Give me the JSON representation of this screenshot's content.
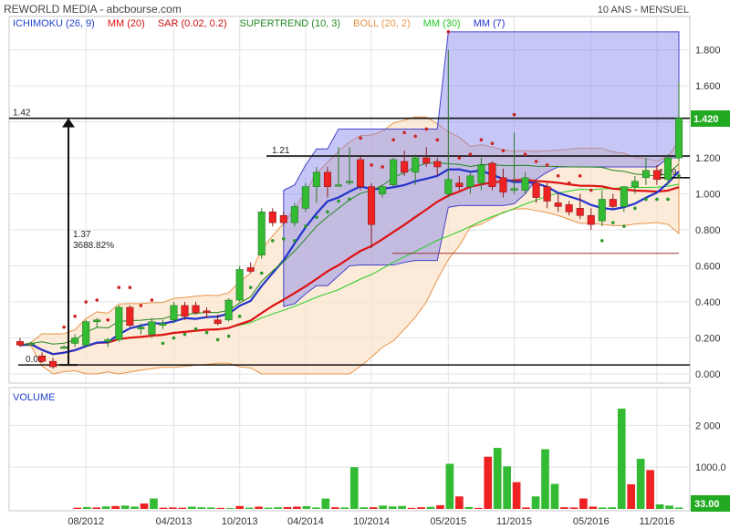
{
  "header": {
    "title": "REWORLD MEDIA - abcbourse.com",
    "period": "10 ANS - MENSUEL"
  },
  "legend": [
    {
      "label": "ICHIMOKU (26, 9)",
      "color": "#2244cc"
    },
    {
      "label": "MM (20)",
      "color": "#dd1111"
    },
    {
      "label": "SAR (0.02, 0.2)",
      "color": "#cc1111"
    },
    {
      "label": "SUPERTREND (10, 3)",
      "color": "#228822"
    },
    {
      "label": "BOLL (20, 2)",
      "color": "#e8944a"
    },
    {
      "label": "MM (30)",
      "color": "#22cc22"
    },
    {
      "label": "MM (7)",
      "color": "#2233cc"
    }
  ],
  "annotations": {
    "high_level": "1.42",
    "resistance": "1.21",
    "support": "1.09",
    "low_level": "0.05",
    "move_abs": "1.37",
    "move_pct": "3688.82%",
    "last_price": "1.420",
    "last_volume": "33.00"
  },
  "volume_panel": {
    "title": "VOLUME"
  },
  "colors": {
    "up": "#33bb33",
    "down": "#ee2222",
    "price_tag": "#22aa22",
    "cloud": "#8080ee"
  },
  "chart_data": [
    {
      "type": "candlestick",
      "title": "REWORLD MEDIA",
      "y_ticks": [
        "0.000",
        "0.200",
        "0.400",
        "0.600",
        "0.800",
        "1.000",
        "1.200",
        "1.400",
        "1.600",
        "1.800"
      ],
      "ylim": [
        0,
        1.95
      ],
      "x_ticks": [
        "08/2012",
        "04/2013",
        "10/2013",
        "04/2014",
        "10/2014",
        "05/2015",
        "11/2015",
        "05/2016",
        "11/2016"
      ],
      "ohlc": [
        [
          0.18,
          0.2,
          0.15,
          0.16
        ],
        [
          0.17,
          0.18,
          0.16,
          0.17
        ],
        [
          0.1,
          0.12,
          0.06,
          0.07
        ],
        [
          0.07,
          0.09,
          0.03,
          0.04
        ],
        [
          0.15,
          0.16,
          0.14,
          0.15
        ],
        [
          0.17,
          0.22,
          0.15,
          0.2
        ],
        [
          0.16,
          0.3,
          0.15,
          0.29
        ],
        [
          0.29,
          0.31,
          0.26,
          0.3
        ],
        [
          0.18,
          0.2,
          0.15,
          0.19
        ],
        [
          0.19,
          0.38,
          0.18,
          0.37
        ],
        [
          0.37,
          0.38,
          0.26,
          0.27
        ],
        [
          0.25,
          0.28,
          0.22,
          0.26
        ],
        [
          0.22,
          0.31,
          0.2,
          0.29
        ],
        [
          0.27,
          0.3,
          0.25,
          0.28
        ],
        [
          0.3,
          0.4,
          0.28,
          0.38
        ],
        [
          0.38,
          0.4,
          0.3,
          0.32
        ],
        [
          0.38,
          0.4,
          0.33,
          0.34
        ],
        [
          0.35,
          0.37,
          0.31,
          0.34
        ],
        [
          0.3,
          0.33,
          0.27,
          0.28
        ],
        [
          0.3,
          0.42,
          0.29,
          0.41
        ],
        [
          0.41,
          0.6,
          0.4,
          0.58
        ],
        [
          0.59,
          0.62,
          0.56,
          0.57
        ],
        [
          0.66,
          0.92,
          0.64,
          0.9
        ],
        [
          0.9,
          0.92,
          0.82,
          0.84
        ],
        [
          0.88,
          0.9,
          0.83,
          0.84
        ],
        [
          0.84,
          0.95,
          0.82,
          0.93
        ],
        [
          0.92,
          1.06,
          0.9,
          1.04
        ],
        [
          1.04,
          1.15,
          0.95,
          1.12
        ],
        [
          1.12,
          1.15,
          0.98,
          1.04
        ],
        [
          1.05,
          1.26,
          1.04,
          1.05
        ],
        [
          1.07,
          1.26,
          1.05,
          1.07
        ],
        [
          1.19,
          1.21,
          1.02,
          1.04
        ],
        [
          1.04,
          1.06,
          0.7,
          0.83
        ],
        [
          1.0,
          1.05,
          0.98,
          1.04
        ],
        [
          1.05,
          1.2,
          1.04,
          1.19
        ],
        [
          1.18,
          1.24,
          1.1,
          1.12
        ],
        [
          1.12,
          1.22,
          1.05,
          1.2
        ],
        [
          1.2,
          1.26,
          1.15,
          1.17
        ],
        [
          1.18,
          1.2,
          1.1,
          1.15
        ],
        [
          1.0,
          1.8,
          0.98,
          1.08
        ],
        [
          1.06,
          1.1,
          1.02,
          1.04
        ],
        [
          1.04,
          1.12,
          1.0,
          1.1
        ],
        [
          1.06,
          1.2,
          1.02,
          1.16
        ],
        [
          1.17,
          1.18,
          1.02,
          1.04
        ],
        [
          1.09,
          1.14,
          0.98,
          1.01
        ],
        [
          1.02,
          1.34,
          1.0,
          1.03
        ],
        [
          1.02,
          1.12,
          1.0,
          1.09
        ],
        [
          1.06,
          1.08,
          0.95,
          0.98
        ],
        [
          1.04,
          1.06,
          0.92,
          0.96
        ],
        [
          0.95,
          1.0,
          0.9,
          0.93
        ],
        [
          0.94,
          0.96,
          0.88,
          0.9
        ],
        [
          0.92,
          1.0,
          0.86,
          0.88
        ],
        [
          0.88,
          0.92,
          0.8,
          0.83
        ],
        [
          0.85,
          1.02,
          0.82,
          0.97
        ],
        [
          0.97,
          1.0,
          0.92,
          0.93
        ],
        [
          0.93,
          1.0,
          0.9,
          1.04
        ],
        [
          1.04,
          1.1,
          1.0,
          1.07
        ],
        [
          1.09,
          1.2,
          1.05,
          1.13
        ],
        [
          1.13,
          1.16,
          1.05,
          1.08
        ],
        [
          1.08,
          1.22,
          1.05,
          1.2
        ],
        [
          1.2,
          1.62,
          1.18,
          1.42
        ]
      ],
      "volume_ticks": [
        "1000.0",
        "2 000"
      ],
      "volume_ylim": [
        0,
        2750
      ],
      "volume": [
        0,
        0,
        0,
        0,
        0,
        0,
        30,
        45,
        35,
        60,
        70,
        80,
        55,
        130,
        250,
        30,
        35,
        30,
        55,
        40,
        35,
        25,
        20,
        70,
        30,
        55,
        30,
        40,
        45,
        55,
        65,
        35,
        250,
        40,
        35,
        1000,
        40,
        40,
        80,
        60,
        70,
        25,
        40,
        50,
        90,
        1080,
        300,
        45,
        25,
        1250,
        1460,
        1020,
        640,
        35,
        300,
        1430,
        600,
        40,
        35,
        250,
        55,
        35,
        40,
        2400,
        590,
        1200,
        930,
        110,
        80,
        33
      ],
      "volume_up": [
        false,
        false,
        false,
        false,
        false,
        false,
        false,
        true,
        false,
        true,
        false,
        true,
        true,
        false,
        true,
        false,
        false,
        false,
        true,
        true,
        true,
        false,
        true,
        false,
        true,
        false,
        true,
        true,
        false,
        false,
        true,
        true,
        true,
        false,
        true,
        true,
        true,
        false,
        true,
        true,
        true,
        false,
        false,
        true,
        false,
        true,
        false,
        true,
        false,
        false,
        true,
        true,
        false,
        false,
        true,
        true,
        true,
        false,
        false,
        false,
        false,
        true,
        true,
        true,
        false,
        true,
        false,
        true,
        true,
        true
      ]
    }
  ]
}
